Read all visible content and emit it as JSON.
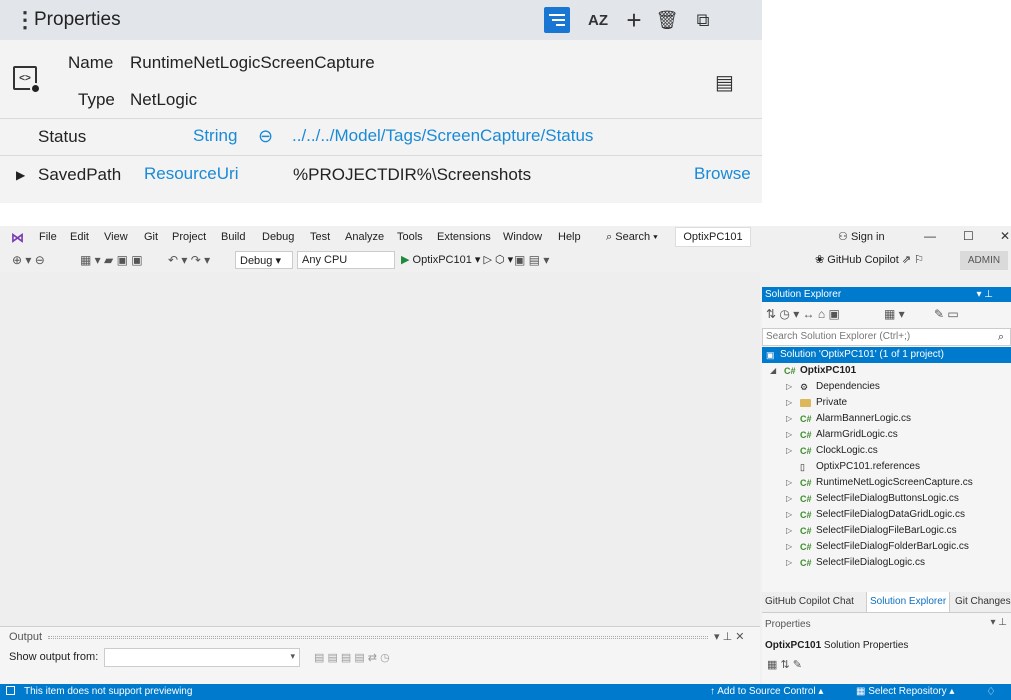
{
  "optix_properties": {
    "title": "Properties",
    "header_buttons": {
      "filter_icon": "filter-lines-icon",
      "sort_label": "AZ",
      "add_icon": "+",
      "delete_icon": "🗑",
      "popout_icon": "⧉"
    },
    "node": {
      "name_label": "Name",
      "name_value": "RuntimeNetLogicScreenCapture",
      "type_label": "Type",
      "type_value": "NetLogic"
    },
    "rows": {
      "status": {
        "label": "Status",
        "type": "String",
        "link_icon": "⊖",
        "path": "../../../Model/Tags/ScreenCapture/Status"
      },
      "saved_path": {
        "label": "SavedPath",
        "type": "ResourceUri",
        "value": "%PROJECTDIR%\\Screenshots",
        "browse_label": "Browse"
      }
    }
  },
  "vs": {
    "menu": [
      "File",
      "Edit",
      "View",
      "Git",
      "Project",
      "Build",
      "Debug",
      "Test",
      "Analyze",
      "Tools",
      "Extensions",
      "Window",
      "Help"
    ],
    "search_label": "Search",
    "solution_title": "OptixPC101",
    "sign_in": "Sign in",
    "toolbar": {
      "config": "Debug",
      "platform": "Any CPU",
      "run_target": "OptixPC101",
      "copilot": "GitHub Copilot",
      "admin": "ADMIN"
    },
    "output": {
      "title": "Output",
      "show_from_label": "Show output from:"
    },
    "solution_explorer": {
      "title": "Solution Explorer",
      "search_placeholder": "Search Solution Explorer (Ctrl+;)",
      "solution_row": "Solution 'OptixPC101' (1 of 1 project)",
      "project": "OptixPC101",
      "items": [
        {
          "label": "Dependencies",
          "kind": "deps",
          "arrow": true
        },
        {
          "label": "Private",
          "kind": "folder",
          "arrow": true
        },
        {
          "label": "AlarmBannerLogic.cs",
          "kind": "cs",
          "arrow": true
        },
        {
          "label": "AlarmGridLogic.cs",
          "kind": "cs",
          "arrow": true
        },
        {
          "label": "ClockLogic.cs",
          "kind": "cs",
          "arrow": true
        },
        {
          "label": "OptixPC101.references",
          "kind": "file",
          "arrow": false
        },
        {
          "label": "RuntimeNetLogicScreenCapture.cs",
          "kind": "cs",
          "arrow": true
        },
        {
          "label": "SelectFileDialogButtonsLogic.cs",
          "kind": "cs",
          "arrow": true
        },
        {
          "label": "SelectFileDialogDataGridLogic.cs",
          "kind": "cs",
          "arrow": true
        },
        {
          "label": "SelectFileDialogFileBarLogic.cs",
          "kind": "cs",
          "arrow": true
        },
        {
          "label": "SelectFileDialogFolderBarLogic.cs",
          "kind": "cs",
          "arrow": true
        },
        {
          "label": "SelectFileDialogLogic.cs",
          "kind": "cs",
          "arrow": true
        }
      ]
    },
    "right_tabs": [
      "GitHub Copilot Chat",
      "Solution Explorer",
      "Git Changes"
    ],
    "properties": {
      "title": "Properties",
      "object_name": "OptixPC101",
      "object_type": "Solution Properties"
    },
    "status": {
      "message": "This item does not support previewing",
      "source_control": "Add to Source Control",
      "repository": "Select Repository"
    },
    "accent_color": "#007acc"
  }
}
